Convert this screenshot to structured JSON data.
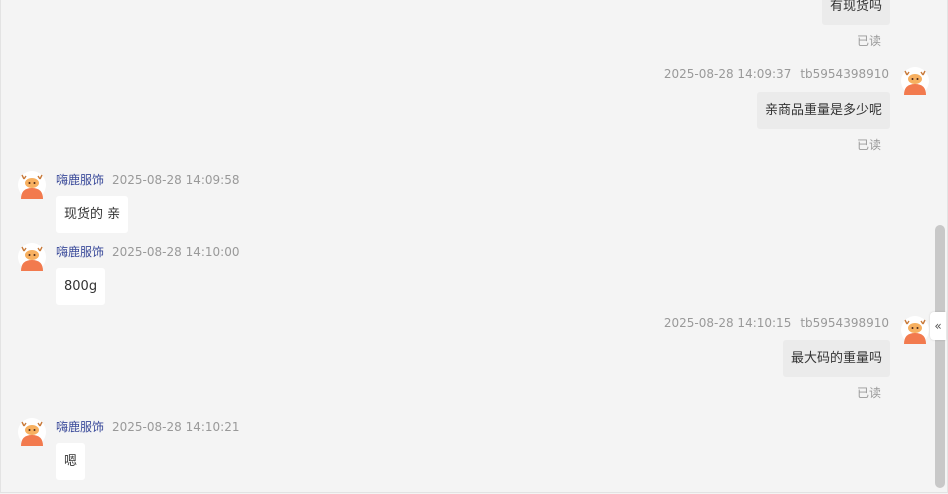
{
  "messages": [
    {
      "side": "out",
      "text": "有现货吗",
      "status": "已读"
    },
    {
      "side": "out",
      "time": "2025-08-28 14:09:37",
      "sender": "tb5954398910",
      "text": "亲商品重量是多少呢",
      "status": "已读"
    },
    {
      "side": "in",
      "sender": "嗨鹿服饰",
      "time": "2025-08-28 14:09:58",
      "text": "现货的 亲"
    },
    {
      "side": "in",
      "sender": "嗨鹿服饰",
      "time": "2025-08-28 14:10:00",
      "text": "800g"
    },
    {
      "side": "out",
      "time": "2025-08-28 14:10:15",
      "sender": "tb5954398910",
      "text": "最大码的重量吗",
      "status": "已读"
    },
    {
      "side": "in",
      "sender": "嗨鹿服饰",
      "time": "2025-08-28 14:10:21",
      "text": "嗯"
    }
  ],
  "side_panel": {
    "collapse_icon": "«"
  },
  "colors": {
    "background": "#f4f4f4",
    "outgoing_bubble": "#ebebeb",
    "incoming_bubble": "#ffffff",
    "sender_name": "#3a4a9a",
    "avatar": "#f27a4e"
  },
  "icons": {
    "avatar": "deer-mascot-icon"
  }
}
